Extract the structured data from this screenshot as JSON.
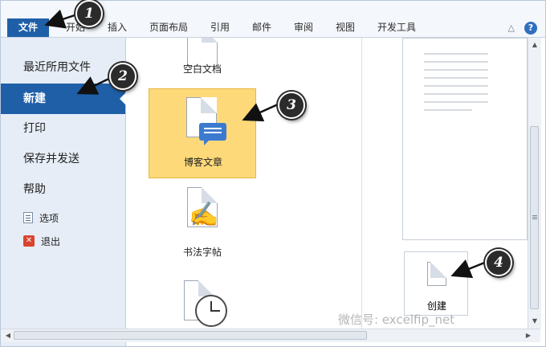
{
  "ribbon": {
    "tabs": [
      "文件",
      "开始",
      "插入",
      "页面布局",
      "引用",
      "邮件",
      "审阅",
      "视图",
      "开发工具"
    ],
    "help_label": "?"
  },
  "nav": {
    "items": [
      "最近所用文件",
      "新建",
      "打印",
      "保存并发送",
      "帮助"
    ],
    "selected": "新建",
    "small_items": [
      "选项",
      "退出"
    ]
  },
  "templates": [
    {
      "label": "空白文档"
    },
    {
      "label": "博客文章",
      "selected": true
    },
    {
      "label": "书法字帖"
    }
  ],
  "create_button": {
    "label": "创建"
  },
  "annotations": [
    "1",
    "2",
    "3",
    "4"
  ],
  "watermark": "微信号: excelfip_net",
  "colors": {
    "accent": "#1f5fa8",
    "selected_template": "#fdd979",
    "badge": "#2b2b2b"
  },
  "icons": [
    "blank-document-icon",
    "blog-post-icon",
    "calligraphy-icon",
    "clock-icon",
    "options-icon",
    "exit-icon",
    "document-icon"
  ]
}
